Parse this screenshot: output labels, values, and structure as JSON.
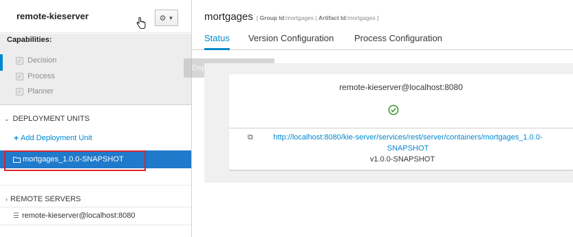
{
  "server": {
    "title": "remote-kieserver",
    "settings_icon": "gear-icon"
  },
  "capabilities": {
    "title": "Capabilities:",
    "items": [
      {
        "label": "Decision",
        "checked": true
      },
      {
        "label": "Process",
        "checked": true
      },
      {
        "label": "Planner",
        "checked": true
      }
    ]
  },
  "deployment_units": {
    "header": "DEPLOYMENT UNITS",
    "add_label": "Add Deployment Unit",
    "items": [
      {
        "label": "mortgages_1.0.0-SNAPSHOT",
        "selected": true
      }
    ]
  },
  "remote_servers": {
    "header": "REMOTE SERVERS",
    "items": [
      {
        "label": "remote-kieserver@localhost:8080"
      }
    ]
  },
  "container": {
    "name": "mortgages",
    "group_label": "Group Id:",
    "group_value": "mortgages",
    "separator": "|",
    "artifact_label": "Artifact Id:",
    "artifact_value": "mortgages",
    "open_bracket": "[",
    "close_bracket": "]"
  },
  "tabs": [
    {
      "label": "Status",
      "active": true
    },
    {
      "label": "Version Configuration",
      "active": false
    },
    {
      "label": "Process Configuration",
      "active": false
    }
  ],
  "tooltip_ghost": "Deploy Unit",
  "status_card": {
    "server": "remote-kieserver@localhost:8080",
    "url_line1": "http://localhost:8080/kie-server/services/rest/server/containers/mortgages_1.0.0-",
    "url_line2": "SNAPSHOT",
    "version": "v1.0.0-SNAPSHOT"
  },
  "colors": {
    "accent": "#0088ce",
    "selected_row": "#1f7acb",
    "highlight_box": "#d9232e",
    "ok_green": "#3f9c35"
  }
}
